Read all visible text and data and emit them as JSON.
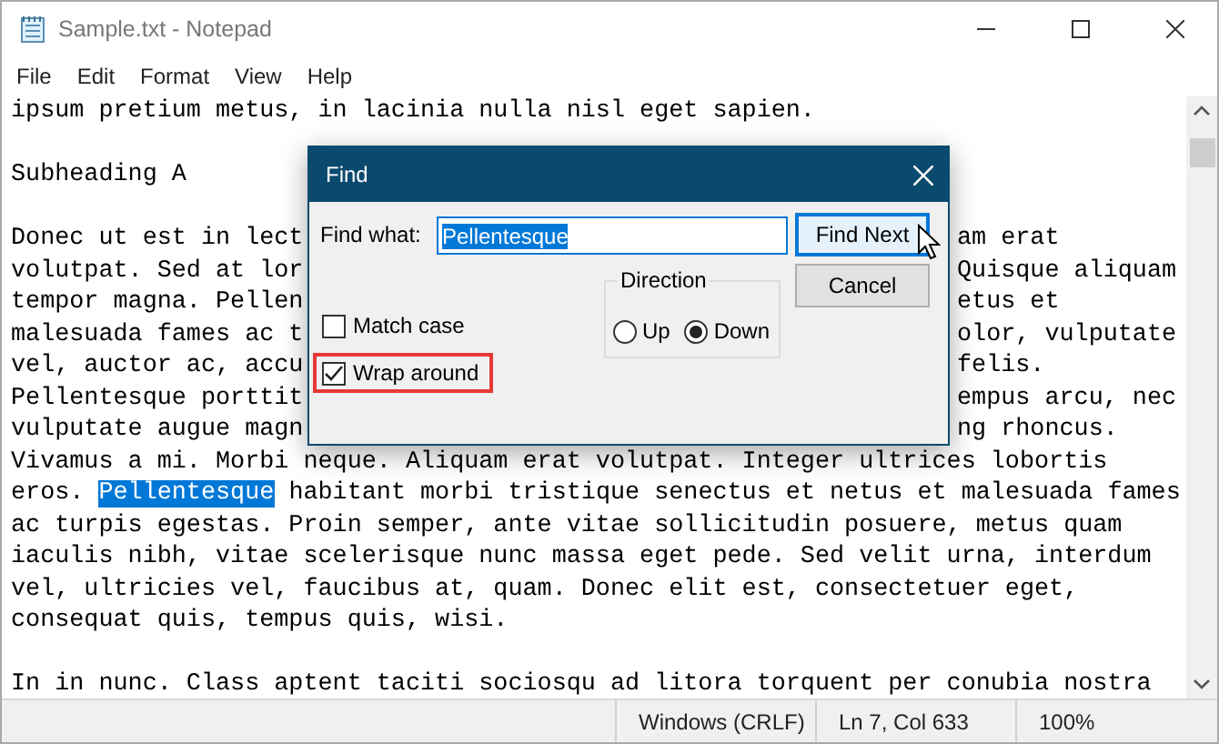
{
  "window": {
    "title": "Sample.txt - Notepad"
  },
  "menu": [
    "File",
    "Edit",
    "Format",
    "View",
    "Help"
  ],
  "editor": {
    "lines": [
      {
        "kind": "plain",
        "text": "ipsum pretium metus, in lacinia nulla nisl eget sapien."
      },
      {
        "kind": "blank"
      },
      {
        "kind": "plain",
        "text": "Subheading A"
      },
      {
        "kind": "blank"
      },
      {
        "kind": "covered",
        "text": "Donec ut est in lect",
        "tail": "am erat"
      },
      {
        "kind": "covered",
        "text": "volutpat. Sed at lor",
        "tail": "Quisque aliquam"
      },
      {
        "kind": "covered",
        "text": "tempor magna. Pellen",
        "tail": "etus et"
      },
      {
        "kind": "covered",
        "text": "malesuada fames ac t",
        "tail": "olor, vulputate"
      },
      {
        "kind": "covered",
        "text": "vel, auctor ac, accu",
        "tail": "felis."
      },
      {
        "kind": "covered",
        "text": "Pellentesque porttit",
        "tail": "empus arcu, nec"
      },
      {
        "kind": "covered",
        "text": "vulputate augue magn",
        "tail": "ng rhoncus."
      },
      {
        "kind": "plain",
        "text": "Vivamus a mi. Morbi neque. Aliquam erat volutpat. Integer ultrices lobortis"
      },
      {
        "kind": "selection",
        "text": "eros. ",
        "selected_text": "Pellentesque",
        "tail": " habitant morbi tristique senectus et netus et malesuada fames"
      },
      {
        "kind": "plain",
        "text": "ac turpis egestas. Proin semper, ante vitae sollicitudin posuere, metus quam"
      },
      {
        "kind": "plain",
        "text": "iaculis nibh, vitae scelerisque nunc massa eget pede. Sed velit urna, interdum"
      },
      {
        "kind": "plain",
        "text": "vel, ultricies vel, faucibus at, quam. Donec elit est, consectetuer eget,"
      },
      {
        "kind": "plain",
        "text": "consequat quis, tempus quis, wisi."
      },
      {
        "kind": "blank"
      },
      {
        "kind": "plain",
        "text": "In in nunc. Class aptent taciti sociosqu ad litora torquent per conubia nostra"
      }
    ]
  },
  "dialog": {
    "title": "Find",
    "find_label": "Find what:",
    "find_value": "Pellentesque",
    "buttons": [
      {
        "label": "Find Next",
        "focused": true
      },
      {
        "label": "Cancel",
        "focused": false
      }
    ],
    "direction": {
      "label": "Direction",
      "options": [
        {
          "label": "Up",
          "selected": false
        },
        {
          "label": "Down",
          "selected": true
        }
      ]
    },
    "checkboxes": [
      {
        "label": "Match case",
        "checked": false,
        "highlighted": false
      },
      {
        "label": "Wrap around",
        "checked": true,
        "highlighted": true
      }
    ]
  },
  "status_bar": [
    "Windows (CRLF)",
    "Ln 7, Col 633",
    "100%"
  ]
}
